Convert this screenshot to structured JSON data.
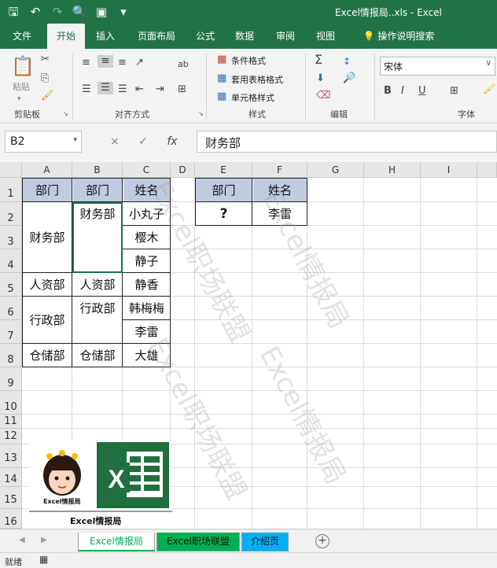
{
  "titlebar": {
    "title": "Excel情报局..xls  -  Excel",
    "icons": [
      "save-icon",
      "undo-icon",
      "redo-icon",
      "print-preview-icon",
      "read-mode-icon",
      "customize-qat-icon"
    ]
  },
  "tabs": [
    "文件",
    "开始",
    "插入",
    "页面布局",
    "公式",
    "数据",
    "审阅",
    "视图",
    "操作说明搜索"
  ],
  "ribbon": {
    "clipboard": {
      "paste": "粘贴",
      "label": "剪贴板"
    },
    "alignment": {
      "label": "对齐方式"
    },
    "styles": {
      "conditional": "条件格式",
      "table_format": "套用表格格式",
      "cell_styles": "单元格样式",
      "label": "样式"
    },
    "editing": {
      "label": "编辑"
    },
    "font": {
      "name": "宋体",
      "label": "字体",
      "bold": "B",
      "italic": "I",
      "underline": "U"
    }
  },
  "formula_bar": {
    "name_box": "B2",
    "cancel": "×",
    "enter": "✓",
    "fx": "fx",
    "content": "财务部"
  },
  "columns": [
    "A",
    "B",
    "C",
    "D",
    "E",
    "F",
    "G",
    "H",
    "I"
  ],
  "rows": [
    "1",
    "2",
    "3",
    "4",
    "5",
    "6",
    "7",
    "8",
    "9",
    "10",
    "11",
    "12",
    "13",
    "14",
    "15",
    "16"
  ],
  "table1": {
    "header": [
      "部门",
      "部门",
      "姓名"
    ],
    "a_merged": [
      "财务部",
      "人资部",
      "行政部",
      "仓储部"
    ],
    "b_merged": [
      "财务部",
      "人资部",
      "行政部",
      "仓储部"
    ],
    "names": [
      "小丸子",
      "樱木",
      "静子",
      "静香",
      "韩梅梅",
      "李雷",
      "大雄"
    ]
  },
  "table2": {
    "header": [
      "部门",
      "姓名"
    ],
    "row": [
      "?",
      "李雷"
    ]
  },
  "watermark": "Excel职场联盟",
  "watermark2": "Excel情报局",
  "logo": {
    "caption": "Excel情报局",
    "badge": "Excel情报局"
  },
  "sheet_tabs": [
    "Excel情报局",
    "Excel职场联盟",
    "介绍页"
  ],
  "status": {
    "ready": "就绪"
  },
  "colors": {
    "excel_green": "#217346",
    "header_fill": "#c0cbe0",
    "tab_green": "#00b050",
    "tab_blue": "#00b0f0",
    "active_tab_text": "#00b050"
  }
}
